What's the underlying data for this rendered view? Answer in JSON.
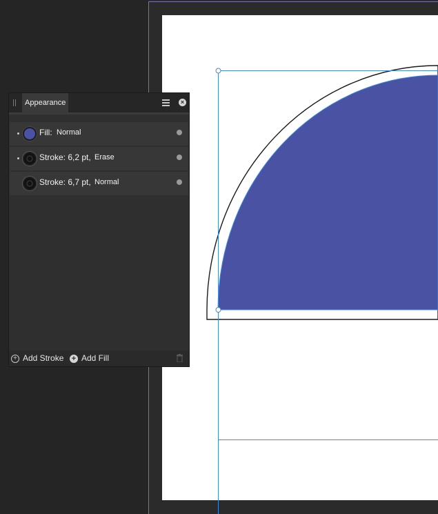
{
  "panel": {
    "tab_label": "Appearance",
    "menu_icon": "hamburger-menu-icon",
    "close_icon": "close-icon",
    "rows": [
      {
        "kind": "fill",
        "label": "Fill:",
        "mode": "Normal",
        "swatch_color": "#4a52a3",
        "has_dot": true
      },
      {
        "kind": "stroke",
        "label": "Stroke: 6,2 pt,",
        "mode": "Erase",
        "swatch_color": "#111111",
        "has_dot": true
      },
      {
        "kind": "stroke",
        "label": "Stroke: 6,7 pt,",
        "mode": "Normal",
        "swatch_color": "#111111",
        "has_dot": false
      }
    ],
    "footer": {
      "add_stroke_label": "Add Stroke",
      "add_fill_label": "Add Fill",
      "delete_icon": "trash-icon"
    }
  },
  "canvas": {
    "shape_fill_color": "#4a52a3",
    "selection_color": "#3d8bd6",
    "artboard_outline_color": "#7a73b0"
  }
}
